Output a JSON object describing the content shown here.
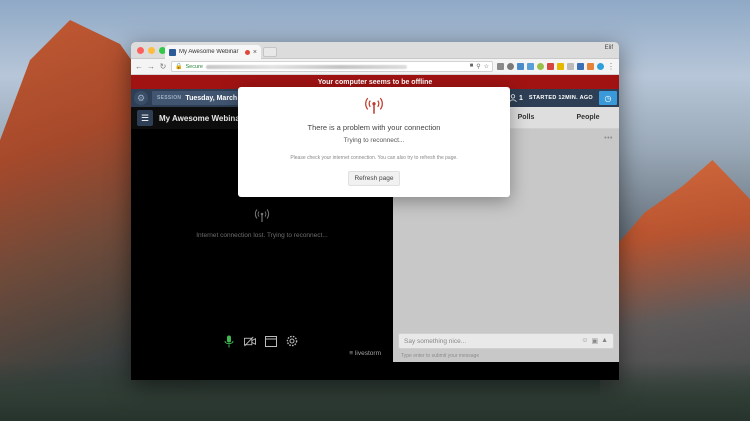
{
  "browser": {
    "tab_title": "My Awesome Webinar",
    "tab_close": "×",
    "profile": "Elif",
    "secure_label": "Secure"
  },
  "offline_banner": "Your computer seems to be offline",
  "header": {
    "session_label": "SESSION",
    "session_date": "Tuesday, March 2",
    "attendee_count": "1",
    "started_label": "STARTED 12MIN. AGO"
  },
  "stage": {
    "title": "My Awesome Webinar",
    "lost_message": "Internet connection lost. Trying to reconnect...",
    "brand": "livestorm"
  },
  "sidebar": {
    "tabs": [
      {
        "label": "Polls"
      },
      {
        "label": "People"
      }
    ],
    "more": "•••",
    "chat_placeholder": "Say something nice...",
    "chat_hint": "Type enter to submit your message"
  },
  "modal": {
    "title": "There is a problem with your connection",
    "subtitle": "Trying to reconnect...",
    "help": "Please check your internet connection. You can also try to refresh the page.",
    "refresh_label": "Refresh page"
  },
  "colors": {
    "offline_red": "#a11313",
    "header_navy": "#2e3f55",
    "accent_blue": "#3a9ad9",
    "mic_green": "#3fb950",
    "signal_red": "#c0392b"
  },
  "icons": {
    "settings": "gear-icon",
    "menu": "hamburger-icon",
    "signal": "broadcast-icon",
    "mic": "microphone-icon",
    "camera": "camera-off-icon",
    "screen": "window-icon",
    "clock": "clock-icon",
    "user": "user-icon"
  }
}
